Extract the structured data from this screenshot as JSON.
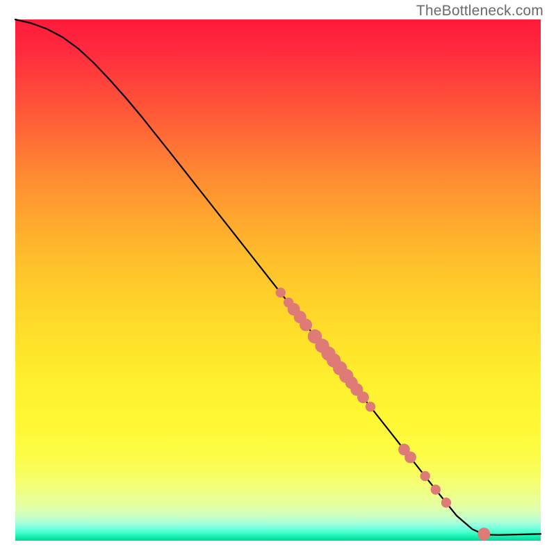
{
  "watermark": "TheBottleneck.com",
  "chart_data": {
    "type": "line",
    "title": "",
    "xlabel": "",
    "ylabel": "",
    "xlim": [
      0,
      100
    ],
    "ylim": [
      0,
      100
    ],
    "grid": false,
    "series": [
      {
        "name": "curve",
        "color": "#000000",
        "x": [
          0,
          3,
          6,
          9,
          12,
          15,
          18,
          21,
          24,
          27,
          30,
          35,
          40,
          45,
          50,
          55,
          60,
          65,
          70,
          75,
          80,
          84,
          87,
          89,
          90,
          92,
          100
        ],
        "y": [
          100,
          99.3,
          98.2,
          96.6,
          94.4,
          91.6,
          88.4,
          85.0,
          81.4,
          77.6,
          73.8,
          67.4,
          61.0,
          54.6,
          48.2,
          41.8,
          35.4,
          29.0,
          22.6,
          16.2,
          9.8,
          4.8,
          2.2,
          1.3,
          1.15,
          1.1,
          1.3
        ]
      }
    ],
    "markers": [
      {
        "x": 50.5,
        "y": 47.6,
        "r": 1.2
      },
      {
        "x": 52.0,
        "y": 45.7,
        "r": 1.2
      },
      {
        "x": 53.0,
        "y": 44.4,
        "r": 1.5
      },
      {
        "x": 54.2,
        "y": 42.9,
        "r": 1.5
      },
      {
        "x": 55.3,
        "y": 41.4,
        "r": 1.5
      },
      {
        "x": 57.0,
        "y": 39.2,
        "r": 1.7
      },
      {
        "x": 58.4,
        "y": 37.4,
        "r": 1.7
      },
      {
        "x": 59.6,
        "y": 35.9,
        "r": 1.7
      },
      {
        "x": 60.6,
        "y": 34.6,
        "r": 1.7
      },
      {
        "x": 61.8,
        "y": 33.1,
        "r": 1.7
      },
      {
        "x": 63.0,
        "y": 31.6,
        "r": 1.7
      },
      {
        "x": 64.0,
        "y": 30.3,
        "r": 1.5
      },
      {
        "x": 65.0,
        "y": 29.0,
        "r": 1.5
      },
      {
        "x": 66.2,
        "y": 27.5,
        "r": 1.4
      },
      {
        "x": 67.6,
        "y": 25.7,
        "r": 1.2
      },
      {
        "x": 74.0,
        "y": 17.5,
        "r": 1.4
      },
      {
        "x": 75.2,
        "y": 16.0,
        "r": 1.4
      },
      {
        "x": 78.0,
        "y": 12.4,
        "r": 1.2
      },
      {
        "x": 80.0,
        "y": 9.8,
        "r": 1.2
      },
      {
        "x": 82.0,
        "y": 7.3,
        "r": 1.2
      },
      {
        "x": 89.2,
        "y": 1.3,
        "r": 1.5
      }
    ],
    "marker_color": "#df7b76"
  }
}
